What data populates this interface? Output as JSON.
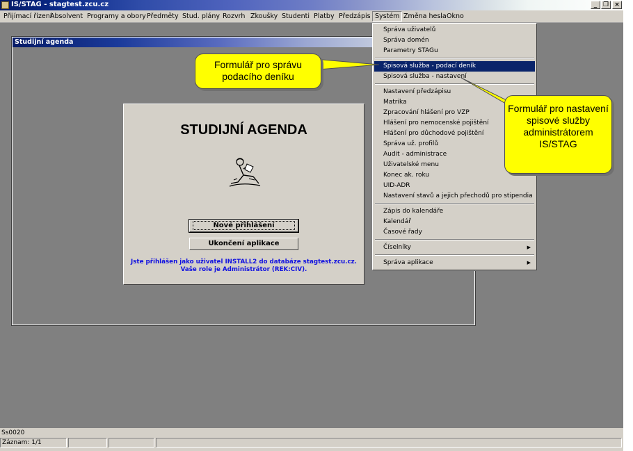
{
  "window": {
    "title": "IS/STAG - stagtest.zcu.cz",
    "controls": {
      "minimize": "_",
      "restore": "❐",
      "close": "×"
    }
  },
  "menubar": {
    "items": [
      "Přijímací řízení",
      "Absolvent",
      "Programy a obory",
      "Předměty",
      "Stud. plány",
      "Rozvrh",
      "Zkoušky",
      "Studenti",
      "Platby",
      "Předzápis",
      "Systém",
      "Změna hesla",
      "Okno"
    ],
    "active": "Systém"
  },
  "inner_window": {
    "title": "Studijní agenda"
  },
  "login_panel": {
    "heading": "STUDIJNÍ AGENDA",
    "new_login_button": "Nové přihlášení",
    "exit_button": "Ukončení aplikace",
    "user_line1": "Jste přihlášen jako uživatel INSTALL2 do databáze stagtest.zcu.cz.",
    "user_line2": "Vaše role je Administrátor (REK:CIV)."
  },
  "system_menu": {
    "group1": [
      "Správa uživatelů",
      "Správa domén",
      "Parametry STAGu"
    ],
    "group2": [
      "Spisová služba - podací deník",
      "Spisová služba - nastavení"
    ],
    "group3": [
      "Nastavení předzápisu",
      "Matrika",
      "Zpracování hlášení pro VZP",
      "Hlášení pro nemocenské pojištění",
      "Hlášení pro důchodové pojištění",
      "Správa už. profilů",
      "Audit - administrace",
      "Uživatelské menu",
      "Konec ak. roku",
      "UID-ADR",
      "Nastavení stavů a jejich přechodů pro stipendia"
    ],
    "group4": [
      "Zápis do kalendáře",
      "Kalendář",
      "Časové řady"
    ],
    "submenus": [
      "Číselníky",
      "Správa aplikace"
    ],
    "selected": "Spisová služba - podací deník",
    "submenu_arrow": "▶"
  },
  "callouts": {
    "left": "Formulář pro správu podacího deníku",
    "right": "Formulář pro nastavení spisové služby administrátorem IS/STAG"
  },
  "statusbar": {
    "form_code": "Ss0020",
    "record": "Záznam: 1/1"
  },
  "colors": {
    "selection": "#0a246a",
    "callout": "#ffff00",
    "info_text": "#1010e0",
    "workspace": "#808080"
  },
  "icons": [
    "app-icon",
    "reading-person-icon",
    "submenu-arrow-icon"
  ]
}
